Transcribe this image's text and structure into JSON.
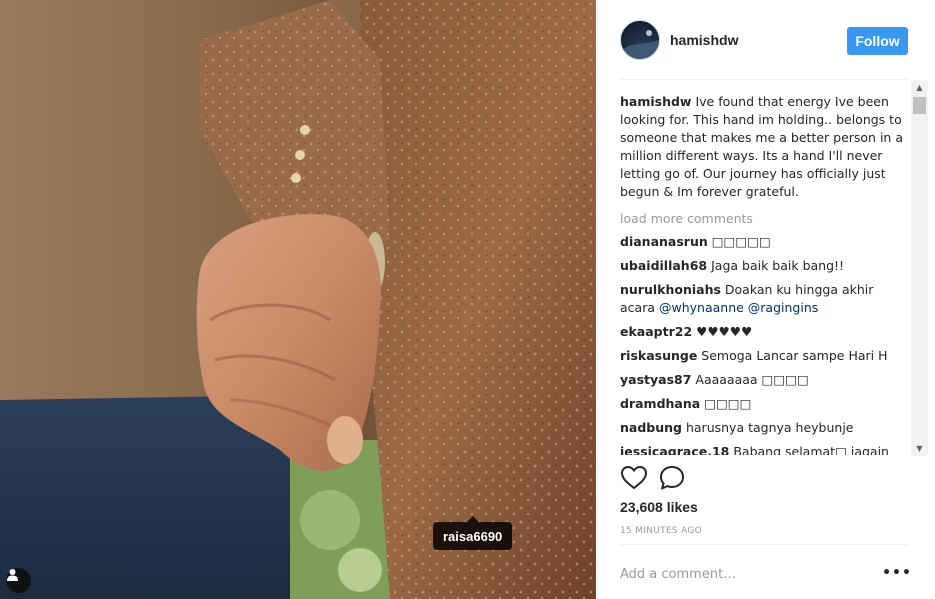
{
  "post": {
    "photo_alt": "",
    "tag_label": "raisa6690"
  },
  "header": {
    "username": "hamishdw",
    "follow_label": "Follow"
  },
  "caption": {
    "username": "hamishdw",
    "text": "Ive found that energy Ive been looking for. This hand im holding.. belongs to someone that makes me a better person in a million different ways. Its a hand I'll never letting go of. Our journey has officially just begun & Im forever grateful."
  },
  "load_more": "load more comments",
  "comments": [
    {
      "user": "diananasrun",
      "text": "□□□□□"
    },
    {
      "user": "ubaidillah68",
      "text": "Jaga baik baik bang!!"
    },
    {
      "user": "nurulkhoniahs",
      "text": "Doakan ku hingga akhir acara",
      "mentions": [
        "@whynaanne",
        "@ragingins"
      ]
    },
    {
      "user": "ekaaptr22",
      "text": "♥♥♥♥♥"
    },
    {
      "user": "riskasunge",
      "text": "Semoga Lancar sampe Hari H"
    },
    {
      "user": "yastyas87",
      "text": "Aaaaaaaa □□□□"
    },
    {
      "user": "dramdhana",
      "text": "□□□□"
    },
    {
      "user": "nadbung",
      "text": "harusnya tagnya heybunje"
    },
    {
      "user": "jessicagrace.18",
      "text": "Babang selamat□ jagain"
    }
  ],
  "stats": {
    "likes": "23,608 likes",
    "time": "15 MINUTES AGO"
  },
  "composer": {
    "placeholder": "Add a comment…",
    "more_label": "•••"
  },
  "icons": {
    "like": "heart-icon",
    "comment": "comment-bubble-icon",
    "user_tag": "user-silhouette-icon",
    "more": "ellipsis-icon"
  },
  "colors": {
    "accent": "#3897f0",
    "mention": "#003569",
    "muted": "#999999"
  }
}
